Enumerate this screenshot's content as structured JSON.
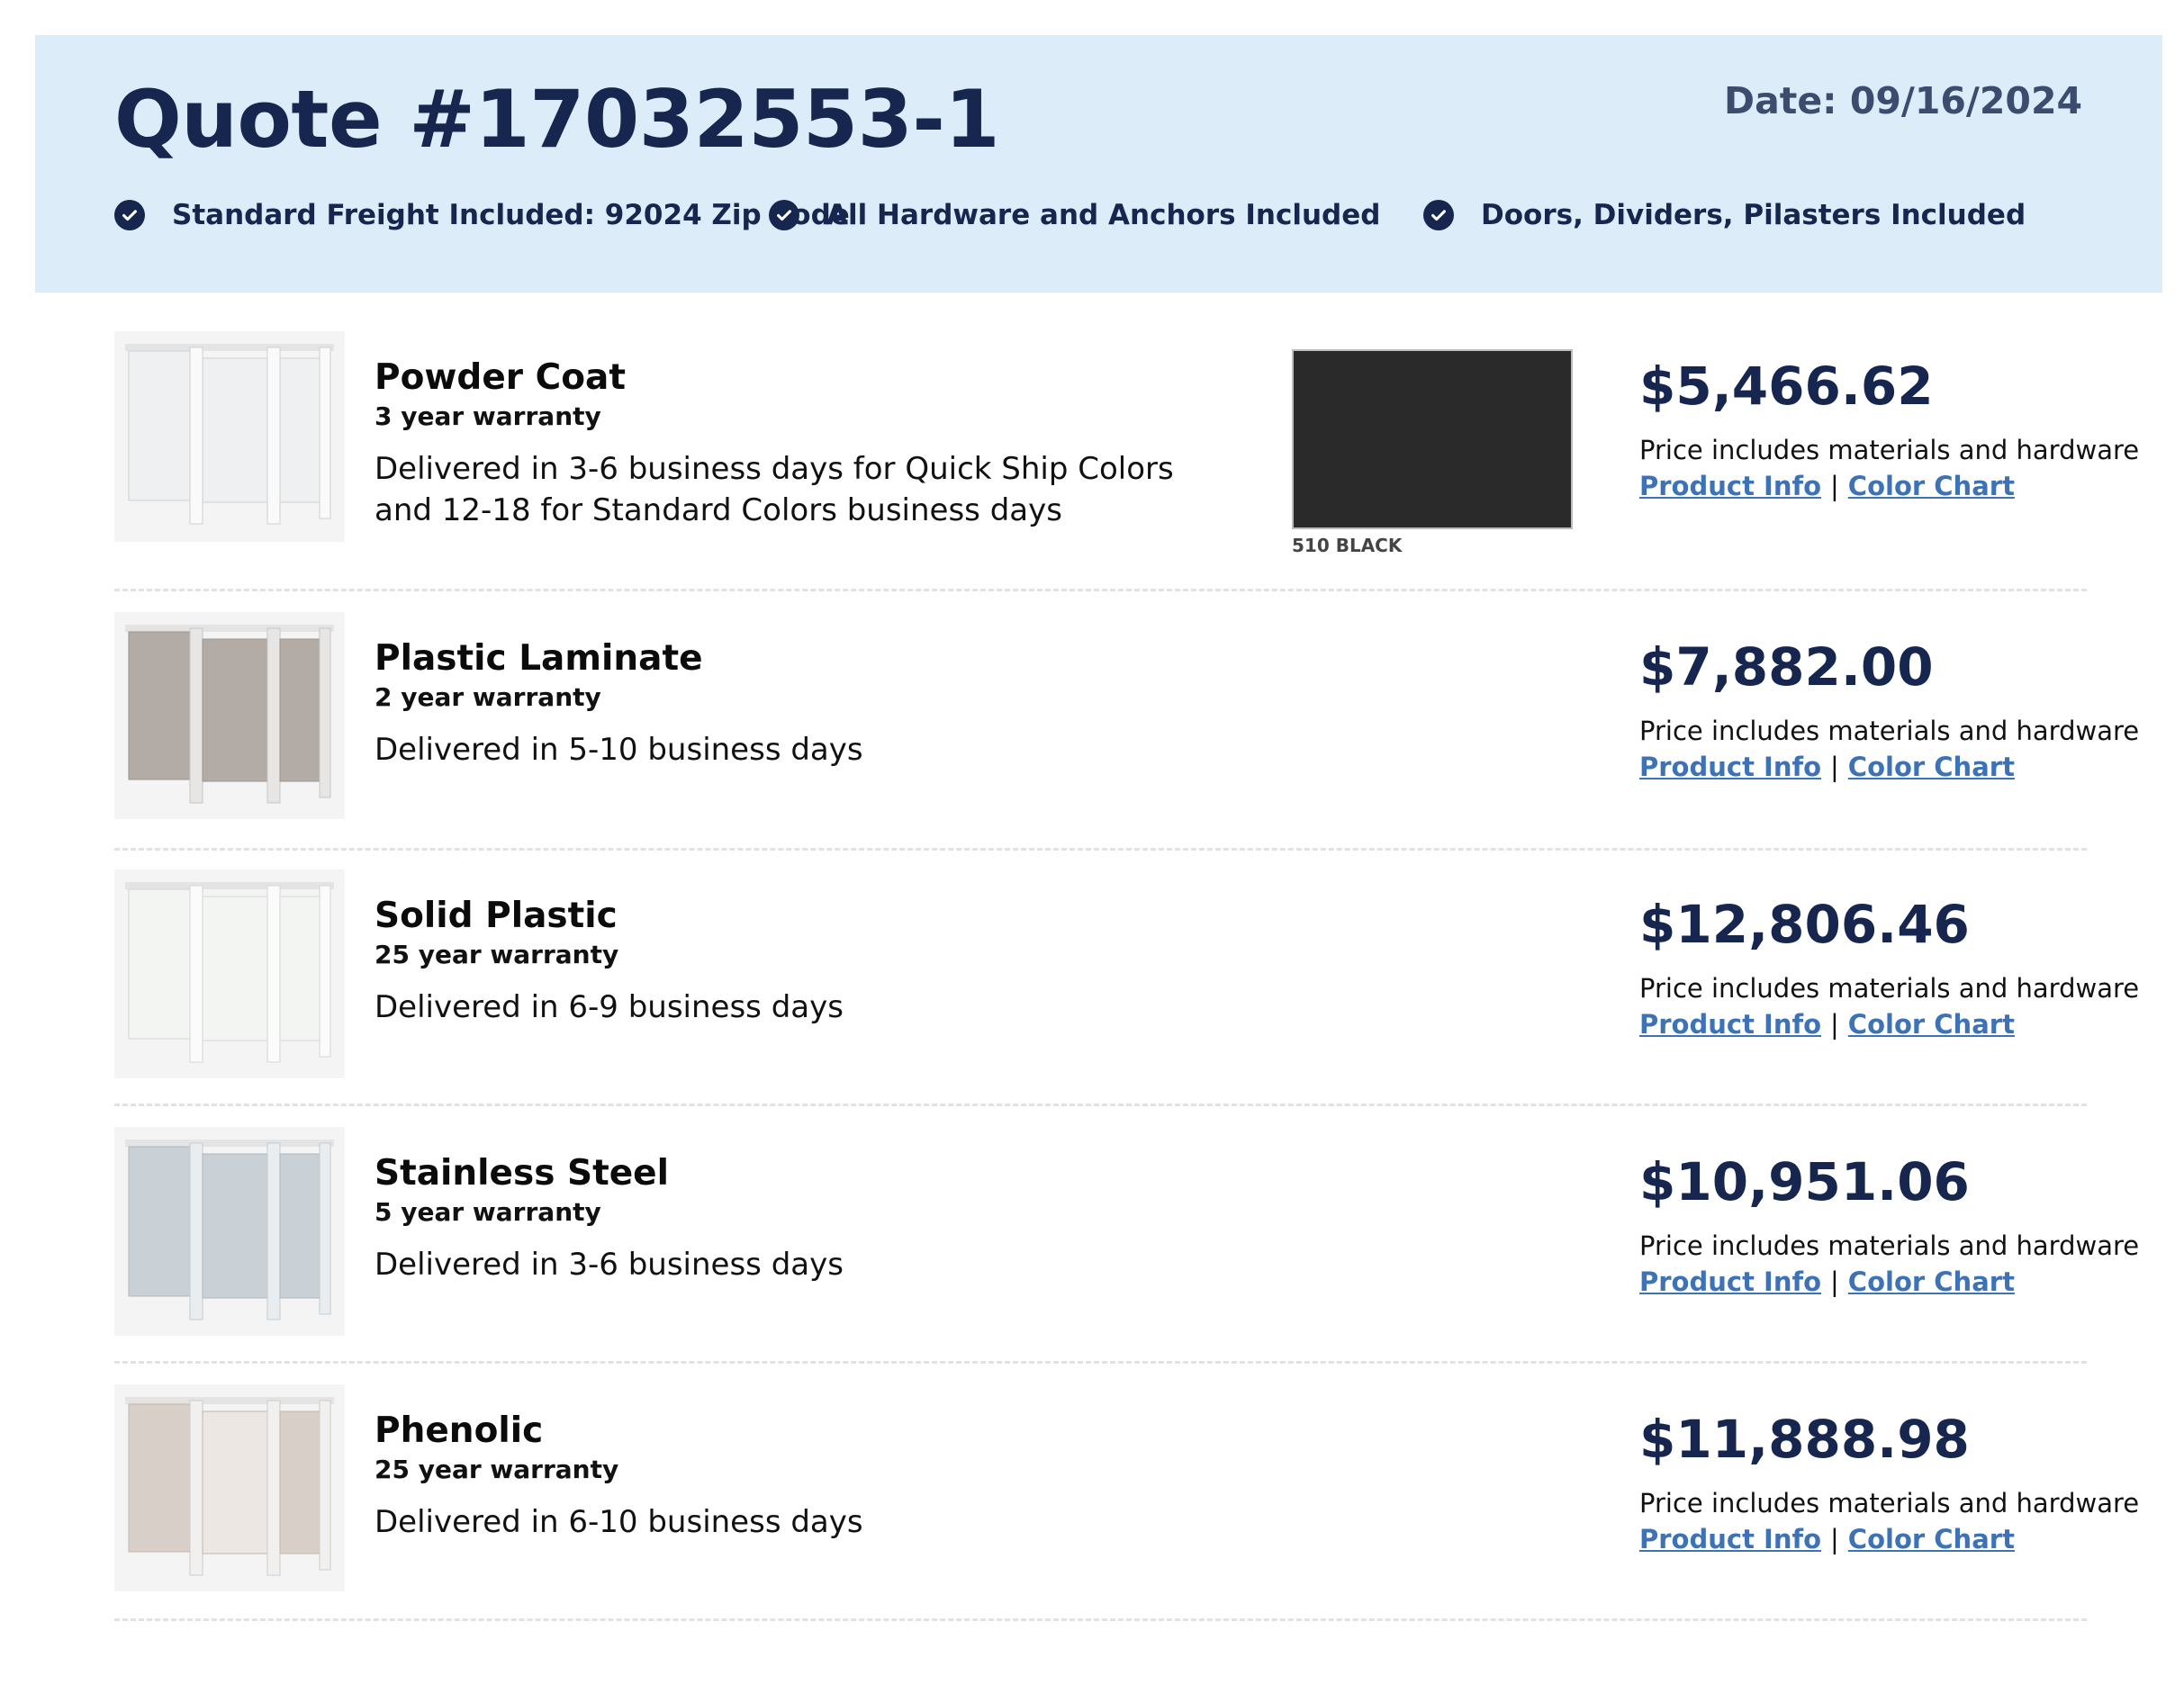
{
  "quote": {
    "title": "Quote #17032553-1",
    "date": "Date: 09/16/2024",
    "features": [
      {
        "icon": "check-circle-icon",
        "text": "Standard Freight Included: 92024 Zip Code"
      },
      {
        "icon": "check-circle-icon",
        "text": "All Hardware and Anchors Included"
      },
      {
        "icon": "check-circle-icon",
        "text": "Doors, Dividers, Pilasters Included"
      }
    ]
  },
  "colors": {
    "header_bg": "#dcedf9",
    "navy": "#16264f",
    "link": "#3d73b6"
  },
  "products": [
    {
      "name": "Powder Coat",
      "warranty": "3 year warranty",
      "delivery": "Delivered in 3-6 business days for Quick Ship Colors and 12-18 for Standard Colors business days",
      "price": "$5,466.62",
      "price_note": "Price includes materials and hardware",
      "product_info": "Product Info",
      "separator": "|",
      "color_chart": "Color Chart",
      "swatch_label": "510 BLACK",
      "swatch_color": "#2a2a2a",
      "panel_color": "#eef0f2"
    },
    {
      "name": "Plastic Laminate",
      "warranty": "2 year warranty",
      "delivery": "Delivered in 5-10 business days",
      "price": "$7,882.00",
      "price_note": "Price includes materials and hardware",
      "product_info": "Product Info",
      "separator": "|",
      "color_chart": "Color Chart",
      "panel_color": "#b3aba6"
    },
    {
      "name": "Solid Plastic",
      "warranty": "25 year warranty",
      "delivery": "Delivered in 6-9 business days",
      "price": "$12,806.46",
      "price_note": "Price includes materials and hardware",
      "product_info": "Product Info",
      "separator": "|",
      "color_chart": "Color Chart",
      "panel_color": "#f3f5f2"
    },
    {
      "name": "Stainless Steel",
      "warranty": "5 year warranty",
      "delivery": "Delivered in 3-6 business days",
      "price": "$10,951.06",
      "price_note": "Price includes materials and hardware",
      "product_info": "Product Info",
      "separator": "|",
      "color_chart": "Color Chart",
      "panel_color": "#c9d0d6"
    },
    {
      "name": "Phenolic",
      "warranty": "25 year warranty",
      "delivery": "Delivered in 6-10 business days",
      "price": "$11,888.98",
      "price_note": "Price includes materials and hardware",
      "product_info": "Product Info",
      "separator": "|",
      "color_chart": "Color Chart",
      "panel_color": "#d8d0c8"
    }
  ]
}
